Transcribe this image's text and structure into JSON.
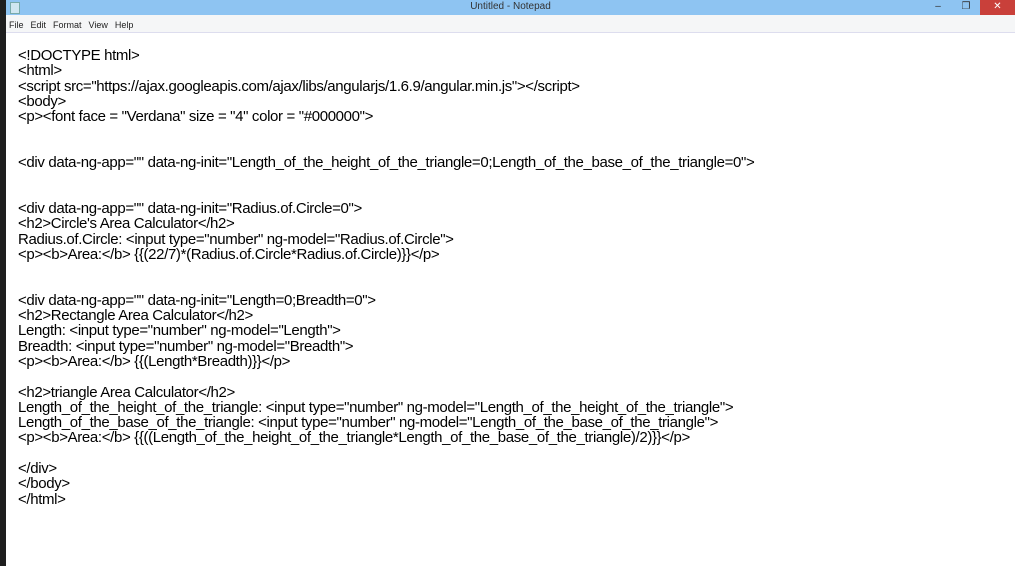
{
  "window": {
    "title": "Untitled - Notepad",
    "minimize": "–",
    "maximize": "❐",
    "close": "✕"
  },
  "menu": [
    "File",
    "Edit",
    "Format",
    "View",
    "Help"
  ],
  "lines": [
    "<!DOCTYPE html>",
    "<html>",
    "<script src=\"https://ajax.googleapis.com/ajax/libs/angularjs/1.6.9/angular.min.js\"></script>",
    "<body>",
    "<p><font face = \"Verdana\" size = \"4\" color = \"#000000\">",
    "",
    "",
    "<div data-ng-app=\"\" data-ng-init=\"Length_of_the_height_of_the_triangle=0;Length_of_the_base_of_the_triangle=0\">",
    "",
    "",
    "<div data-ng-app=\"\" data-ng-init=\"Radius.of.Circle=0\">",
    "<h2>Circle's Area Calculator</h2>",
    "Radius.of.Circle: <input type=\"number\" ng-model=\"Radius.of.Circle\">",
    "<p><b>Area:</b> {{(22/7)*(Radius.of.Circle*Radius.of.Circle)}}</p>",
    "",
    "",
    "<div data-ng-app=\"\" data-ng-init=\"Length=0;Breadth=0\">",
    "<h2>Rectangle Area Calculator</h2>",
    "Length: <input type=\"number\" ng-model=\"Length\">",
    "Breadth: <input type=\"number\" ng-model=\"Breadth\">",
    "<p><b>Area:</b> {{(Length*Breadth)}}</p>",
    "",
    "<h2>triangle Area Calculator</h2>",
    "Length_of_the_height_of_the_triangle: <input type=\"number\" ng-model=\"Length_of_the_height_of_the_triangle\">",
    "Length_of_the_base_of_the_triangle: <input type=\"number\" ng-model=\"Length_of_the_base_of_the_triangle\">",
    "<p><b>Area:</b> {{((Length_of_the_height_of_the_triangle*Length_of_the_base_of_the_triangle)/2)}}</p>",
    "",
    "</div>",
    "</body>",
    "</html>"
  ]
}
